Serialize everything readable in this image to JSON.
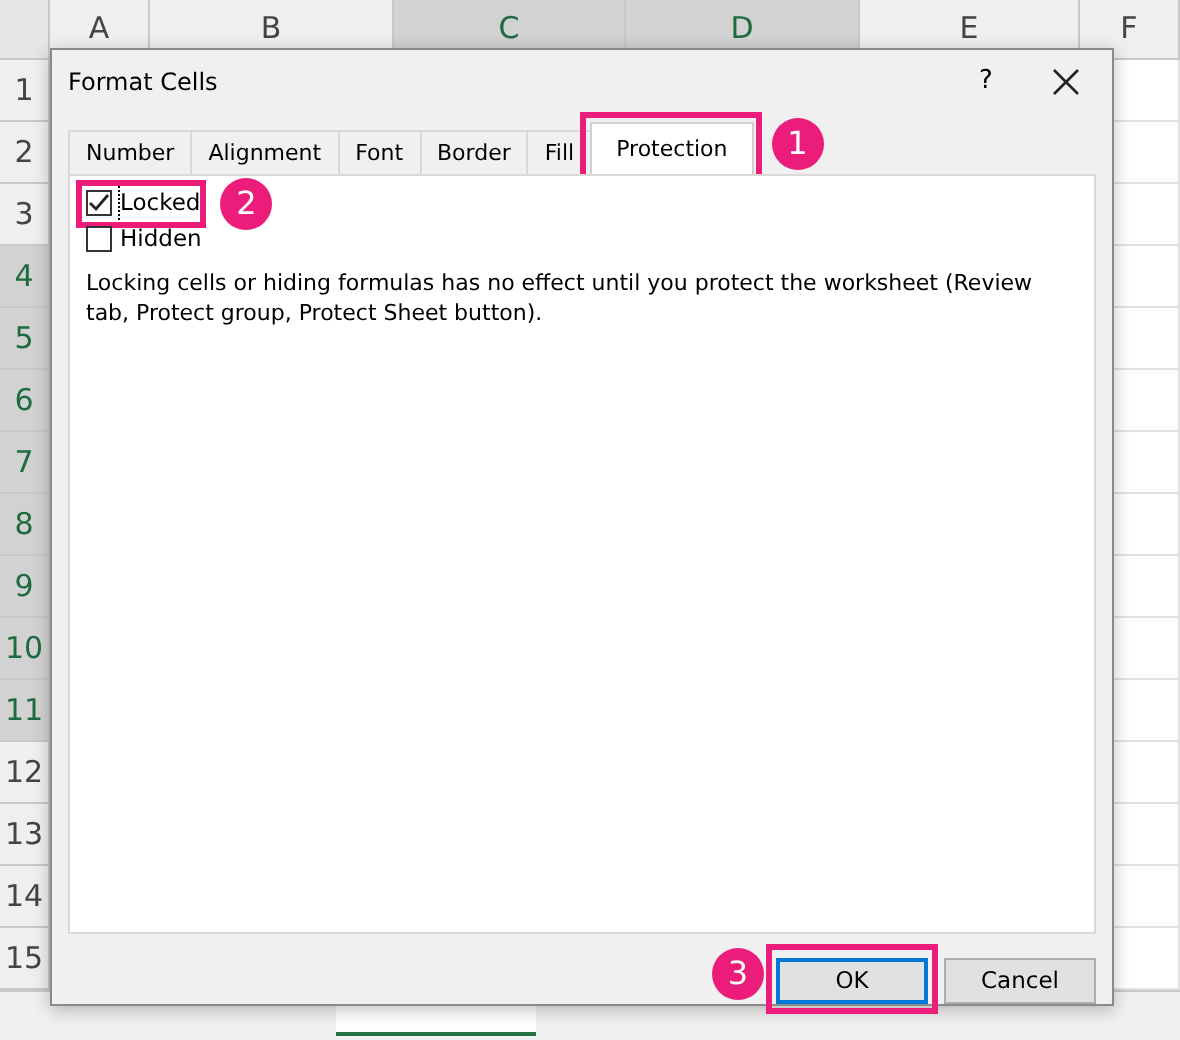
{
  "spreadsheet": {
    "columns": [
      {
        "label": "A",
        "selected": false
      },
      {
        "label": "B",
        "selected": false
      },
      {
        "label": "C",
        "selected": true
      },
      {
        "label": "D",
        "selected": true
      },
      {
        "label": "E",
        "selected": false
      },
      {
        "label": "F",
        "selected": false
      }
    ],
    "rows": [
      {
        "label": "1",
        "selected": false
      },
      {
        "label": "2",
        "selected": false
      },
      {
        "label": "3",
        "selected": false
      },
      {
        "label": "4",
        "selected": true
      },
      {
        "label": "5",
        "selected": true
      },
      {
        "label": "6",
        "selected": true
      },
      {
        "label": "7",
        "selected": true
      },
      {
        "label": "8",
        "selected": true
      },
      {
        "label": "9",
        "selected": true
      },
      {
        "label": "10",
        "selected": true
      },
      {
        "label": "11",
        "selected": true
      },
      {
        "label": "12",
        "selected": false
      },
      {
        "label": "13",
        "selected": false
      },
      {
        "label": "14",
        "selected": false
      },
      {
        "label": "15",
        "selected": false
      }
    ]
  },
  "dialog": {
    "title": "Format Cells",
    "help": "?",
    "tabs": [
      {
        "label": "Number",
        "selected": false
      },
      {
        "label": "Alignment",
        "selected": false
      },
      {
        "label": "Font",
        "selected": false
      },
      {
        "label": "Border",
        "selected": false
      },
      {
        "label": "Fill",
        "selected": false
      },
      {
        "label": "Protection",
        "selected": true,
        "callout": "1"
      }
    ],
    "options": [
      {
        "label": "Locked",
        "checked": true,
        "callout": "2"
      },
      {
        "label": "Hidden",
        "checked": false
      }
    ],
    "note": "Locking cells or hiding formulas has no effect until you protect the worksheet (Review tab, Protect group, Protect Sheet button).",
    "buttons": [
      {
        "label": "OK",
        "default": true,
        "callout": "3"
      },
      {
        "label": "Cancel",
        "default": false
      }
    ]
  }
}
